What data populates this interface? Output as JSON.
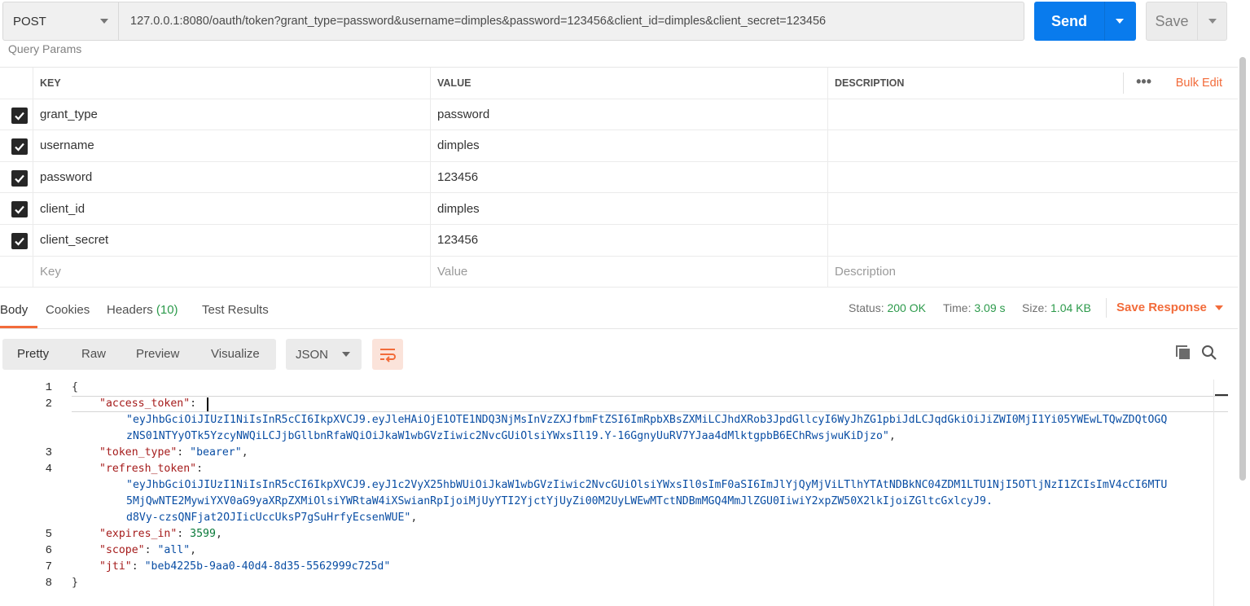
{
  "request": {
    "method": "POST",
    "url": "127.0.0.1:8080/oauth/token?grant_type=password&username=dimples&password=123456&client_id=dimples&client_secret=123456",
    "send_label": "Send",
    "save_label": "Save"
  },
  "query_params": {
    "title": "Query Params",
    "headers": {
      "key": "KEY",
      "value": "VALUE",
      "description": "DESCRIPTION",
      "more": "•••",
      "bulk_edit": "Bulk Edit"
    },
    "rows": [
      {
        "key": "grant_type",
        "value": "password",
        "description": ""
      },
      {
        "key": "username",
        "value": "dimples",
        "description": ""
      },
      {
        "key": "password",
        "value": "123456",
        "description": ""
      },
      {
        "key": "client_id",
        "value": "dimples",
        "description": ""
      },
      {
        "key": "client_secret",
        "value": "123456",
        "description": ""
      }
    ],
    "placeholders": {
      "key": "Key",
      "value": "Value",
      "description": "Description"
    }
  },
  "response": {
    "tabs": {
      "body": "Body",
      "cookies": "Cookies",
      "headers": "Headers",
      "headers_count": "(10)",
      "tests": "Test Results"
    },
    "status_label": "Status:",
    "status_value": "200 OK",
    "time_label": "Time:",
    "time_value": "3.09 s",
    "size_label": "Size:",
    "size_value": "1.04 KB",
    "save_response": "Save Response",
    "view_modes": {
      "pretty": "Pretty",
      "raw": "Raw",
      "preview": "Preview",
      "visualize": "Visualize"
    },
    "format": "JSON"
  },
  "body_json": {
    "access_token": "eyJhbGciOiJIUzI1NiIsInR5cCI6IkpXVCJ9.eyJleHAiOjE1OTE1NDQ3NjMsInVzZXJfbmFtZSI6ImRpbXBsZXMiLCJhdXRob3JpdGllcyI6WyJhZG1pbiJdLCJqdGkiOiJiZWI0MjI1Yi05YWEwLTQwZDQtOGQzNS01NTYyOTk5YzcyNWQiLCJjbGllbnRfaWQiOiJkaW1wbGVzIiwic2NvcGUiOlsiYWxsIl19.Y-16GgnyUuRV7YJaa4dMlktgpbB6EChRwsjwuKiDjzo",
    "token_type": "bearer",
    "refresh_token": "eyJhbGciOiJIUzI1NiIsInR5cCI6IkpXVCJ9.eyJ1c2VyX25hbWUiOiJkaW1wbGVzIiwic2NvcGUiOlsiYWxsIl0sImF0aSI6ImJlYjQyMjViLTlhYTAtNDBkNC04ZDM1LTU1NjI5OTljNzI1ZCIsImV4cCI6MTU5MjQwNTE2MywiYXV0aG9yaXRpZXMiOlsiYWRtaW4iXSwianRpIjoiMjUyYTI2YjctYjUyZi00M2UyLWEwMTctNDBmMGQ4MmJlZGU0IiwiY2xpZW50X2lkIjoiZGltcGxlcyJ9.d8Vy-czsQNFjat2OJIicUccUksP7gSuHrfyEcsenWUE",
    "expires_in": 3599,
    "scope": "all",
    "jti": "beb4225b-9aa0-40d4-8d35-5562999c725d"
  },
  "code_lines": {
    "l1": "{",
    "l2_key": "\"access_token\"",
    "l2a": "\"eyJhbGciOiJIUzI1NiIsInR5cCI6IkpXVCJ9.eyJleHAiOjE1OTE1NDQ3NjMsInVzZXJfbmFtZSI6ImRpbXBsZXMiLCJhdXRob3JpdGllcyI6WyJhZG1pbiJdLCJqdGkiOiJiZWI0MjI1Yi05YWEwLTQwZDQtOGQ",
    "l2b": "zNS01NTYyOTk5YzcyNWQiLCJjbGllbnRfaWQiOiJkaW1wbGVzIiwic2NvcGUiOlsiYWxsIl19.Y-16GgnyUuRV7YJaa4dMlktgpbB6EChRwsjwuKiDjzo\"",
    "l3_key": "\"token_type\"",
    "l3_val": "\"bearer\"",
    "l4_key": "\"refresh_token\"",
    "l4a": "\"eyJhbGciOiJIUzI1NiIsInR5cCI6IkpXVCJ9.eyJ1c2VyX25hbWUiOiJkaW1wbGVzIiwic2NvcGUiOlsiYWxsIl0sImF0aSI6ImJlYjQyMjViLTlhYTAtNDBkNC04ZDM1LTU1NjI5OTljNzI1ZCIsImV4cCI6MTU",
    "l4b": "5MjQwNTE2MywiYXV0aG9yaXRpZXMiOlsiYWRtaW4iXSwianRpIjoiMjUyYTI2YjctYjUyZi00M2UyLWEwMTctNDBmMGQ4MmJlZGU0IiwiY2xpZW50X2lkIjoiZGltcGxlcyJ9.",
    "l4c": "d8Vy-czsQNFjat2OJIicUccUksP7gSuHrfyEcsenWUE\"",
    "l5_key": "\"expires_in\"",
    "l5_val": "3599",
    "l6_key": "\"scope\"",
    "l6_val": "\"all\"",
    "l7_key": "\"jti\"",
    "l7_val": "\"beb4225b-9aa0-40d4-8d35-5562999c725d\"",
    "l8": "}",
    "n1": "1",
    "n2": "2",
    "n3": "3",
    "n4": "4",
    "n5": "5",
    "n6": "6",
    "n7": "7",
    "n8": "8"
  },
  "colors": {
    "accent": "#f26b3a",
    "send": "#097bed",
    "success": "#2c9a4b"
  }
}
